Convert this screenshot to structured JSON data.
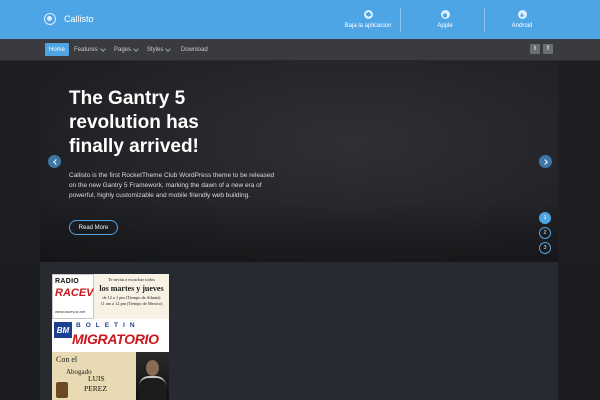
{
  "site": {
    "title": "Callisto"
  },
  "app_links": [
    {
      "label": "Baja la aplicacion",
      "icon": "cloud-download-icon"
    },
    {
      "label": "Apple",
      "icon": "apple-icon"
    },
    {
      "label": "Android",
      "icon": "android-icon"
    }
  ],
  "nav": {
    "items": [
      {
        "label": "Home",
        "active": true
      },
      {
        "label": "Features",
        "dropdown": true
      },
      {
        "label": "Pages",
        "dropdown": true
      },
      {
        "label": "Styles",
        "dropdown": true
      },
      {
        "label": "Download"
      }
    ],
    "social": [
      {
        "glyph": "t",
        "icon": "twitter-icon"
      },
      {
        "glyph": "f",
        "icon": "facebook-icon"
      }
    ]
  },
  "hero": {
    "title": "The Gantry 5 revolution has finally arrived!",
    "text": "Callisto is the first RocketTheme Club WordPress theme to be released on the new Gantry 5 Framework, marking the dawn of a new era of powerful, highly customizable and mobile friendly web building.",
    "button": "Read More",
    "dots": [
      "1",
      "2",
      "3"
    ],
    "active_dot": 1
  },
  "ad": {
    "radio_top": "RADIO",
    "radio_main": "RACEVOZ",
    "radio_url": "www.racevoz.net",
    "invite_line1": "Te invita a escuchar todos",
    "invite_line2": "los martes y jueves",
    "invite_line3": "de 12 a 1 pm (Tiempo de Atlanta)",
    "invite_line4": "11 am a 12 pm (Tiempo de Mexico)",
    "bn": "BM",
    "boletin": "BOLETIN",
    "migratorio": "MIGRATORIO",
    "con_el": "Con el",
    "abogado": "Abogado",
    "name_first": "LUIS",
    "name_last": "PEREZ"
  },
  "colors": {
    "accent": "#4ea5e6",
    "nav_bg": "#3a3b3f",
    "page_bg": "#1e1f23"
  }
}
